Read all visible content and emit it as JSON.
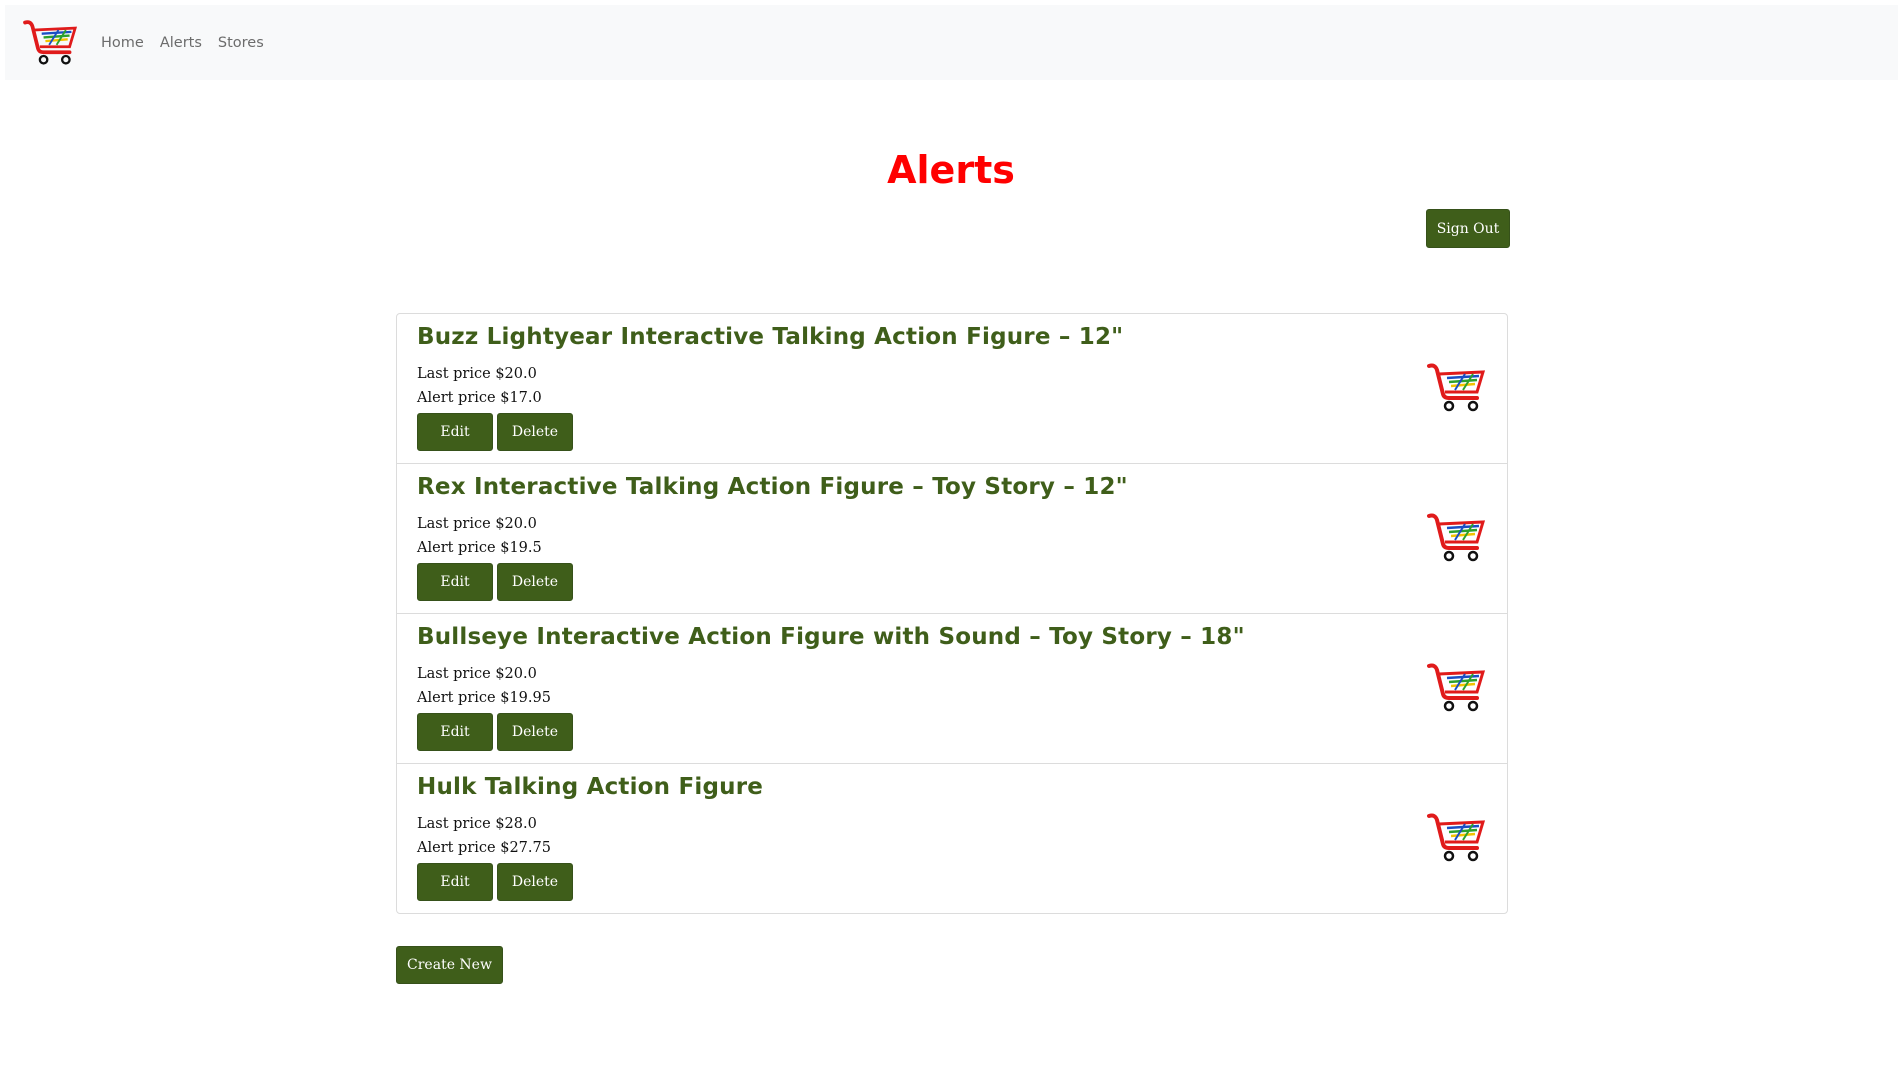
{
  "nav": {
    "brand_icon": "shopping-cart-logo",
    "links": [
      "Home",
      "Alerts",
      "Stores"
    ]
  },
  "page": {
    "title": "Alerts",
    "sign_out_label": "Sign Out",
    "create_label": "Create New"
  },
  "alerts": [
    {
      "name": "Buzz Lightyear Interactive Talking Action Figure – 12\"",
      "last_price": "Last price $20.0",
      "alert_price": "Alert price $17.0",
      "edit_label": "Edit",
      "delete_label": "Delete"
    },
    {
      "name": "Rex Interactive Talking Action Figure – Toy Story – 12\"",
      "last_price": "Last price $20.0",
      "alert_price": "Alert price $19.5",
      "edit_label": "Edit",
      "delete_label": "Delete"
    },
    {
      "name": "Bullseye Interactive Action Figure with Sound – Toy Story – 18\"",
      "last_price": "Last price $20.0",
      "alert_price": "Alert price $19.95",
      "edit_label": "Edit",
      "delete_label": "Delete"
    },
    {
      "name": "Hulk Talking Action Figure",
      "last_price": "Last price $28.0",
      "alert_price": "Alert price $27.75",
      "edit_label": "Edit",
      "delete_label": "Delete"
    }
  ],
  "colors": {
    "accent": "#3f5e1a",
    "title": "#ff0000",
    "navbar_bg": "#f8f9fa"
  }
}
